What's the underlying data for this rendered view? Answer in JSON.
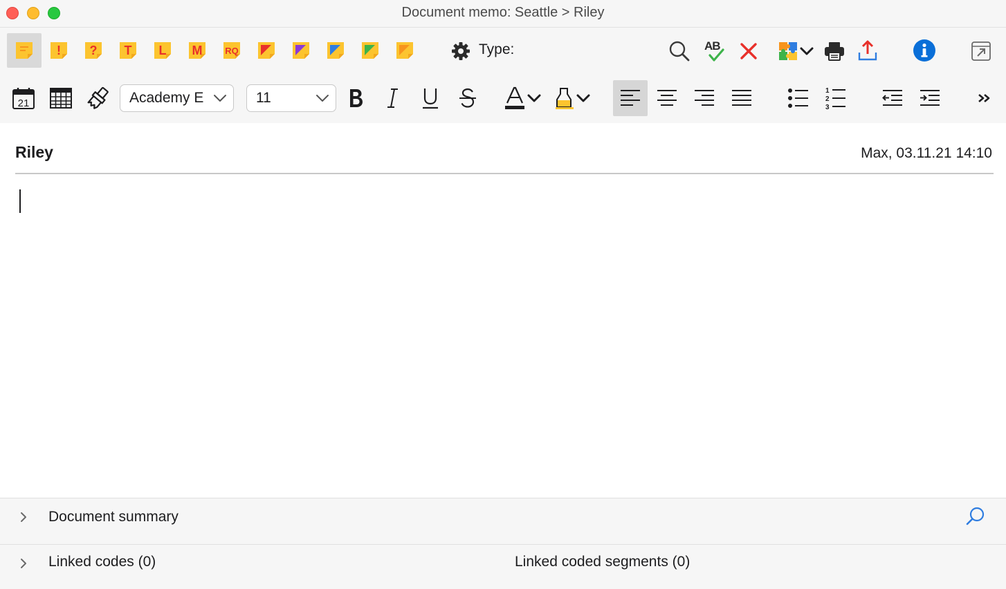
{
  "window": {
    "title": "Document memo: Seattle > Riley"
  },
  "toolbar": {
    "memo_types": [
      {
        "name": "memo-default-icon",
        "label": "",
        "mark_color": "#f7941d"
      },
      {
        "name": "memo-exclamation-icon",
        "label": "!",
        "mark_color": "#e8302a"
      },
      {
        "name": "memo-question-icon",
        "label": "?",
        "mark_color": "#e8302a"
      },
      {
        "name": "memo-t-icon",
        "label": "T",
        "mark_color": "#e8302a"
      },
      {
        "name": "memo-l-icon",
        "label": "L",
        "mark_color": "#e8302a"
      },
      {
        "name": "memo-m-icon",
        "label": "M",
        "mark_color": "#e8302a"
      },
      {
        "name": "memo-rq-icon",
        "label": "RQ",
        "mark_color": "#e8302a"
      },
      {
        "name": "memo-red-corner-icon",
        "label": "",
        "mark_color": "#e8302a"
      },
      {
        "name": "memo-purple-corner-icon",
        "label": "",
        "mark_color": "#8a3ad8"
      },
      {
        "name": "memo-blue-corner-icon",
        "label": "",
        "mark_color": "#2f7de0"
      },
      {
        "name": "memo-green-corner-icon",
        "label": "",
        "mark_color": "#3db34a"
      },
      {
        "name": "memo-orange-corner-icon",
        "label": "",
        "mark_color": "#f7941d"
      }
    ],
    "type_label": "Type:",
    "spellcheck_label": "AB",
    "font_name": "Academy E",
    "font_size": "11"
  },
  "editor": {
    "document_name": "Riley",
    "meta": "Max, 03.11.21 14:10",
    "content": ""
  },
  "panels": {
    "summary_label": "Document summary",
    "linked_codes_label": "Linked codes (0)",
    "linked_segments_label": "Linked coded segments (0)"
  },
  "colors": {
    "memo_yellow": "#fcc42f",
    "memo_yellow_dark": "#f2a81d",
    "info_blue": "#0a6fd8",
    "delete_red": "#e8302a",
    "check_green": "#3db34a",
    "export_red": "#e8302a",
    "export_blue": "#2f7de0",
    "search_link_blue": "#2f7de0"
  }
}
